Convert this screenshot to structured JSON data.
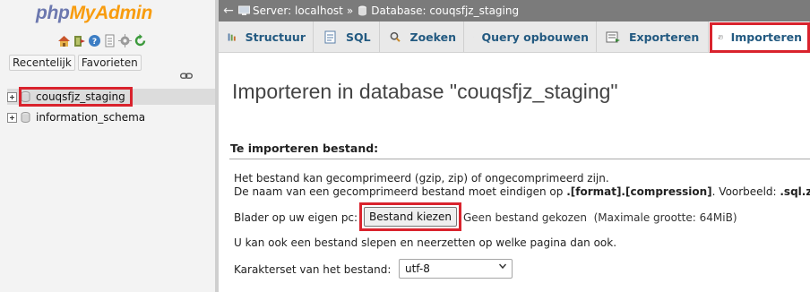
{
  "nav": {
    "logo_part1": "php",
    "logo_part2": "MyAdmin",
    "icons": [
      "home-icon",
      "exit-icon",
      "help-icon",
      "docs-icon",
      "settings-icon",
      "reload-icon"
    ],
    "tabs": [
      "Recentelijk",
      "Favorieten"
    ],
    "databases": [
      {
        "name": "couqsfjz_staging"
      },
      {
        "name": "information_schema"
      }
    ]
  },
  "breadcrumb": {
    "server": "Server: localhost",
    "separator": "»",
    "database": "Database: couqsfjz_staging"
  },
  "tabs": [
    {
      "label": "Structuur",
      "icon": "structure-icon"
    },
    {
      "label": "SQL",
      "icon": "sql-icon"
    },
    {
      "label": "Zoeken",
      "icon": "search-icon"
    },
    {
      "label": "Query opbouwen",
      "icon": "query-icon"
    },
    {
      "label": "Exporteren",
      "icon": "export-icon"
    },
    {
      "label": "Importeren",
      "icon": "import-icon",
      "active": true
    }
  ],
  "main": {
    "title": "Importeren in database \"couqsfjz_staging\"",
    "section_heading": "Te importeren bestand:",
    "line1": "Het bestand kan gecomprimeerd (gzip, zip) of ongecomprimeerd zijn.",
    "line2_prefix": "De naam van een gecomprimeerd bestand moet eindigen op ",
    "line2_bold": ".[format].[compression]",
    "line2_middle": ". Voorbeeld: ",
    "line2_example": ".sql.zip",
    "browse_label": "Blader op uw eigen pc:",
    "file_button": "Bestand kiezen",
    "no_file": "Geen bestand gekozen  (Maximale grootte: 64MiB)",
    "drag_text": "U kan ook een bestand slepen en neerzetten op welke pagina dan ook.",
    "charset_label": "Karakterset van het bestand:",
    "charset_value": "utf-8"
  },
  "colors": {
    "highlight": "#d9232d",
    "link": "#235a81",
    "logo_blue": "#6c78af",
    "logo_orange": "#f89c0e",
    "breadcrumb_bg": "#7b7b7b"
  }
}
